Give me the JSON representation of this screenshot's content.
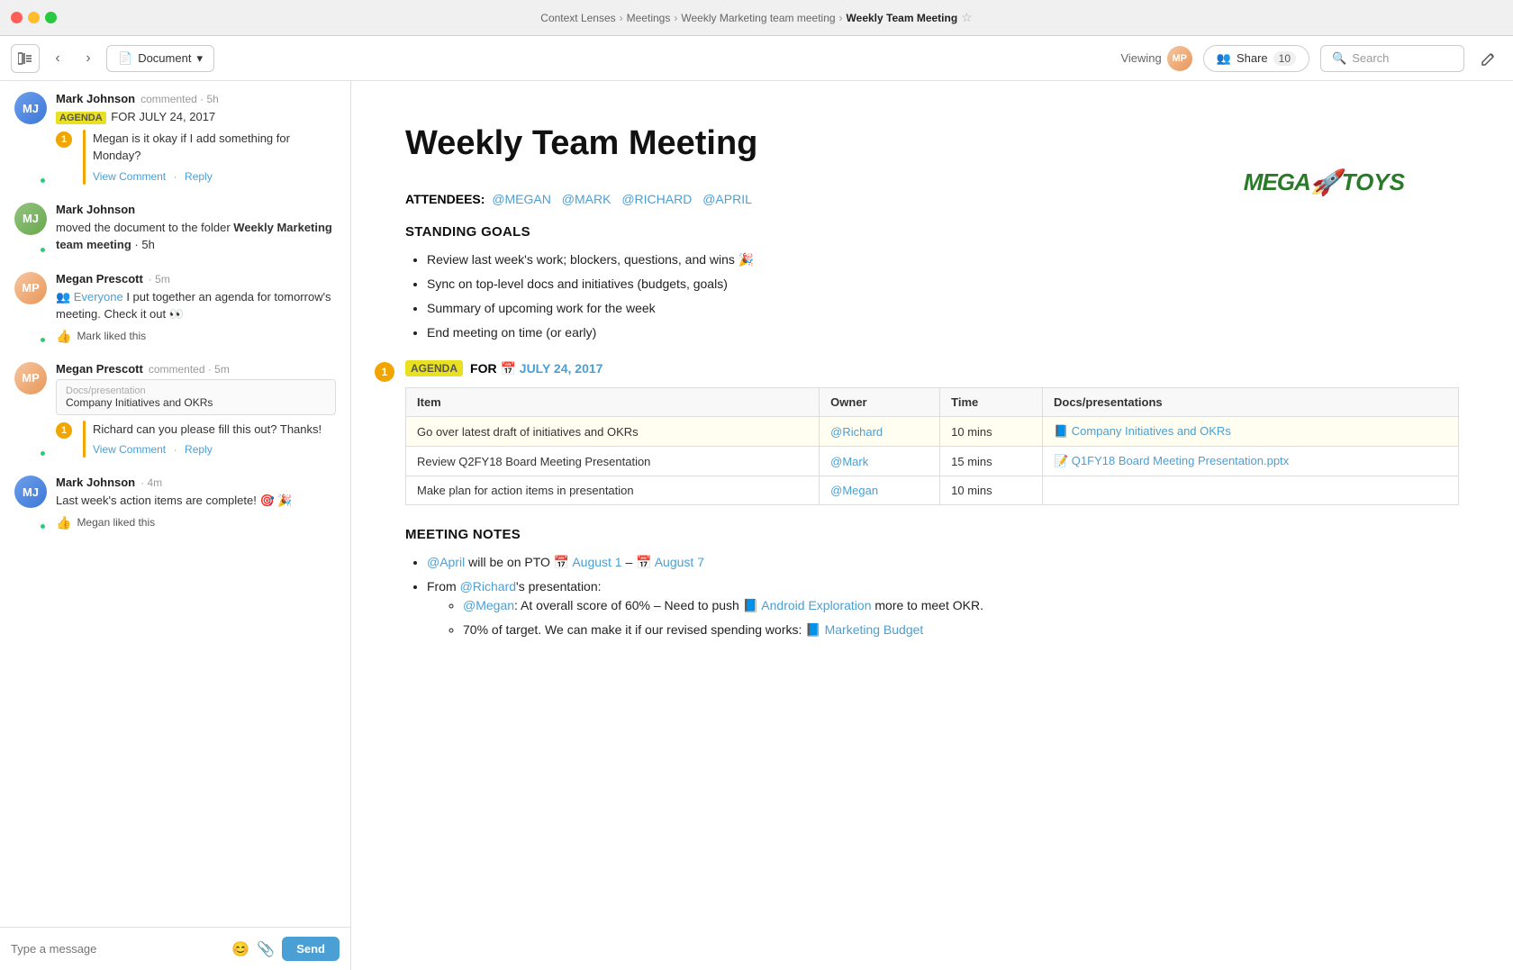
{
  "titlebar": {
    "breadcrumbs": [
      "Context Lenses",
      "Meetings",
      "Weekly Marketing team meeting",
      "Weekly Team Meeting"
    ],
    "star_label": "☆"
  },
  "toolbar": {
    "sidebar_toggle_label": "⊟",
    "back_label": "‹",
    "forward_label": "›",
    "document_label": "Document",
    "viewing_label": "Viewing",
    "share_label": "Share",
    "share_count": "10",
    "search_placeholder": "Search",
    "edit_label": "✎"
  },
  "chat": {
    "send_label": "Send",
    "input_placeholder": "Type a message",
    "emoji_icon": "😊",
    "attach_icon": "🔗",
    "messages": [
      {
        "id": "msg1",
        "author": "Mark Johnson",
        "action": "commented",
        "time": "5h",
        "avatar": "MJ",
        "avatar_type": "mark",
        "online": true,
        "agenda_tag": "AGENDA",
        "text_prefix": "FOR JULY 24, 2017",
        "comment_number": "1",
        "comment_text": "Megan is it okay if I add something for Monday?",
        "view_link": "View Comment",
        "reply_link": "Reply"
      },
      {
        "id": "msg2",
        "author": "Mark Johnson",
        "action": "moved the document to the folder Weekly Marketing team meeting",
        "time": "5h",
        "avatar": "MJ",
        "avatar_type": "mark2",
        "online": true
      },
      {
        "id": "msg3",
        "author": "Megan Prescott",
        "action": "",
        "time": "5m",
        "avatar": "MP",
        "avatar_type": "megan",
        "online": true,
        "mention": "@Everyone",
        "text": "I put together an agenda for tomorrow's meeting. Check it out 👀",
        "like_icon": "👍",
        "like_text": "Mark liked this"
      },
      {
        "id": "msg4",
        "author": "Megan Prescott",
        "action": "commented",
        "time": "5m",
        "avatar": "MP",
        "avatar_type": "megan",
        "online": true,
        "doc_path": "Docs/presentation",
        "doc_name": "Company Initiatives and OKRs",
        "comment_number": "1",
        "comment_text": "Richard can you please fill this out? Thanks!",
        "view_link": "View Comment",
        "reply_link": "Reply"
      },
      {
        "id": "msg5",
        "author": "Mark Johnson",
        "action": "",
        "time": "4m",
        "avatar": "MJ",
        "avatar_type": "mark",
        "online": true,
        "text": "Last week's action items are complete! 🎯 🎉",
        "like_icon": "👍",
        "like_text": "Megan liked this"
      }
    ]
  },
  "document": {
    "title": "Weekly Team Meeting",
    "logo": "MEGA🚀TOYS",
    "attendees_label": "ATTENDEES:",
    "attendees": [
      "@MEGAN",
      "@MARK",
      "@RICHARD",
      "@APRIL"
    ],
    "standing_goals_heading": "STANDING GOALS",
    "goals": [
      "Review last week's work; blockers, questions, and wins 🎉",
      "Sync on top-level docs and initiatives (budgets, goals)",
      "Summary of upcoming work for the week",
      "End meeting on time (or early)"
    ],
    "agenda_badge": "AGENDA",
    "agenda_for": "FOR",
    "agenda_date": "📅 JULY 24, 2017",
    "agenda_number": "1",
    "agenda_table": {
      "headers": [
        "Item",
        "Owner",
        "Time",
        "Docs/presentations"
      ],
      "rows": [
        {
          "item": "Go over latest draft of initiatives and OKRs",
          "owner": "@Richard",
          "time": "10 mins",
          "doc": "📘 Company Initiatives and OKRs",
          "highlight": true
        },
        {
          "item": "Review Q2FY18 Board Meeting Presentation",
          "owner": "@Mark",
          "time": "15 mins",
          "doc": "📝 Q1FY18 Board Meeting Presentation.pptx",
          "highlight": false
        },
        {
          "item": "Make plan for action items in presentation",
          "owner": "@Megan",
          "time": "10 mins",
          "doc": "",
          "highlight": false
        }
      ]
    },
    "meeting_notes_heading": "MEETING NOTES",
    "notes": [
      {
        "type": "bullet",
        "text_prefix": "",
        "mention": "@April",
        "text": " will be on PTO 📅 August 1 – 📅 August 7"
      },
      {
        "type": "bullet",
        "mention": "@Richard",
        "text": "'s presentation:",
        "sub": [
          {
            "mention": "@Megan",
            "text": ": At overall score of 60% – Need to push 📘 Android Exploration more to meet OKR."
          },
          {
            "text": "70% of target. We can make it if our revised spending works: 📘 Marketing Budget"
          }
        ]
      }
    ]
  }
}
